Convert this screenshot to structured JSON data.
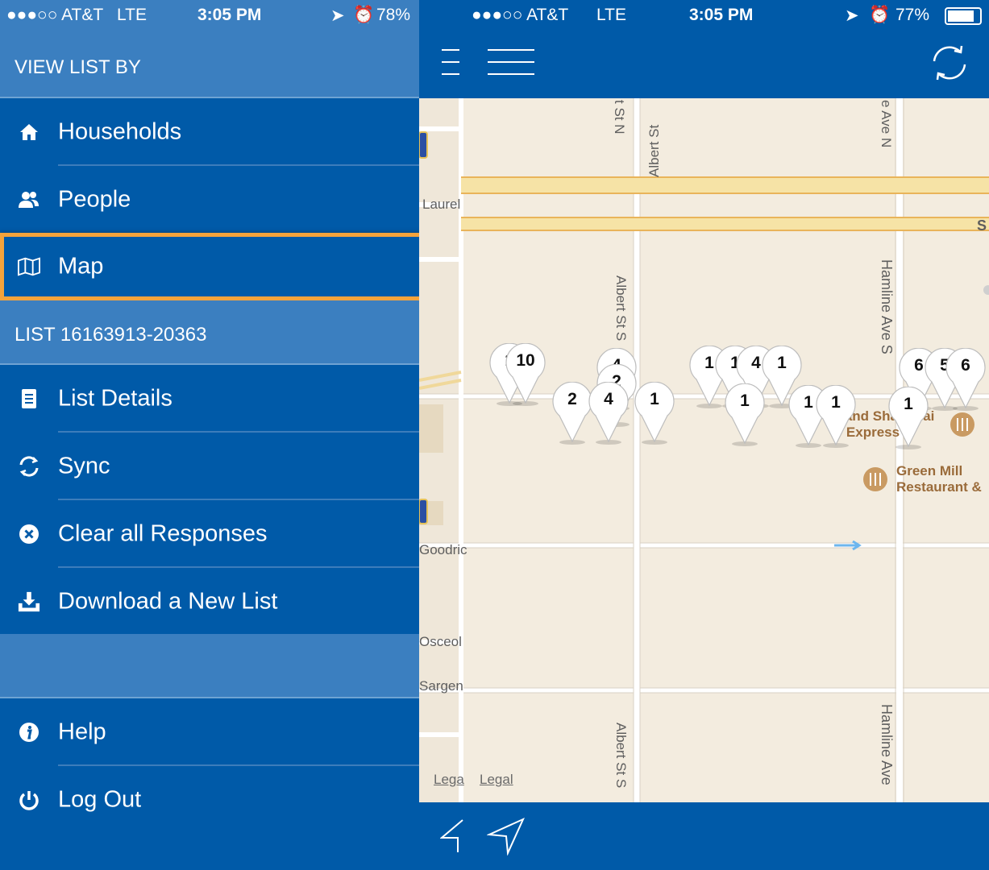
{
  "left_status": {
    "carrier": "●●●○○ AT&T",
    "network": "LTE",
    "time": "3:05 PM",
    "battery": "78%"
  },
  "right_status": {
    "carrier": "●●●○○ AT&T",
    "network": "LTE",
    "time": "3:05 PM",
    "battery": "77%"
  },
  "drawer": {
    "view_list_header": "VIEW LIST BY",
    "view_items": [
      {
        "label": "Households",
        "icon": "home-icon"
      },
      {
        "label": "People",
        "icon": "people-icon"
      },
      {
        "label": "Map",
        "icon": "map-icon",
        "selected": true
      }
    ],
    "list_header": "LIST 16163913-20363",
    "list_items": [
      {
        "label": "List Details",
        "icon": "document-icon"
      },
      {
        "label": "Sync",
        "icon": "sync-icon"
      },
      {
        "label": "Clear all Responses",
        "icon": "clear-icon"
      },
      {
        "label": "Download a New List",
        "icon": "download-icon"
      }
    ],
    "footer_items": [
      {
        "label": "Help",
        "icon": "info-icon"
      },
      {
        "label": "Log Out",
        "icon": "power-icon"
      }
    ]
  },
  "map": {
    "streets": {
      "albert_top": "t St N",
      "albert_mid1": "Albert St",
      "albert_mid2": "Albert St S",
      "albert_bottom": "Albert St S",
      "hamline_top": "e Ave N",
      "hamline_mid": "Hamline Ave S",
      "hamline_bottom": "Hamline Ave",
      "laurel": "Laurel",
      "goodrich": "Goodric",
      "osceola": "Osceol",
      "sargent": "Sargen",
      "edge_s": "S"
    },
    "pois": {
      "grand_shanghai_line1": "Grand Shanghai",
      "grand_shanghai_line2": "Express",
      "green_mill_line1": "Green Mill",
      "green_mill_line2": "Restaurant &"
    },
    "legal_left": "Lega",
    "legal_right": "Legal",
    "pins": [
      "1",
      "10",
      "4",
      "2",
      "2",
      "4",
      "1",
      "1",
      "1",
      "4",
      "1",
      "1",
      "1",
      "1",
      "6",
      "5",
      "6",
      "1"
    ]
  },
  "colors": {
    "brand_blue": "#005aa8",
    "header_blue": "#3b7fc0",
    "highlight_orange": "#f4a33b",
    "map_bg": "#f3ecdf",
    "highway": "#f6e3a6"
  }
}
